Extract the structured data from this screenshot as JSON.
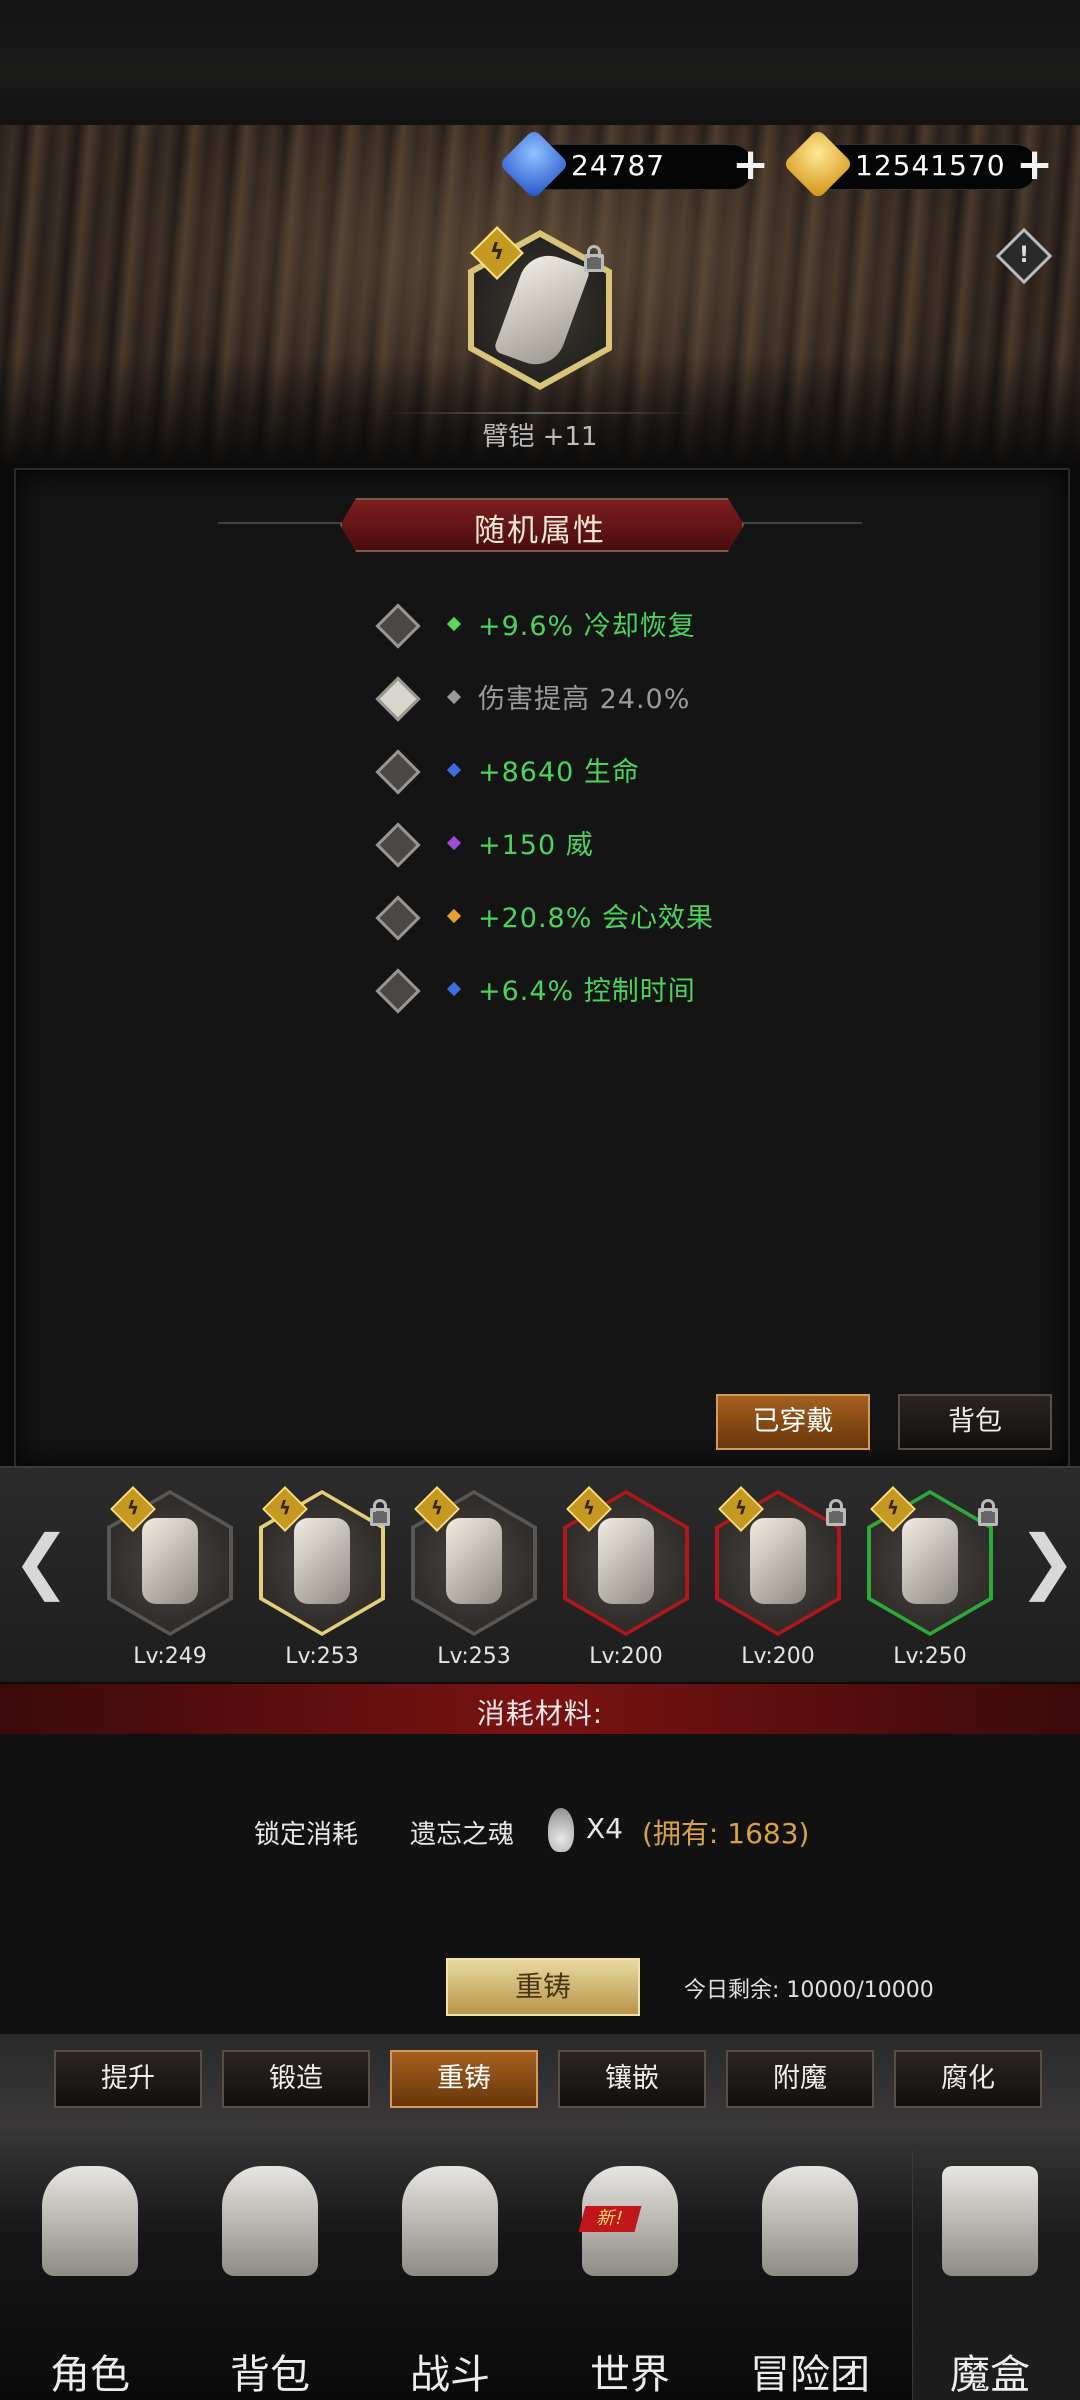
{
  "currency": {
    "gems": "24787",
    "gold": "12541570",
    "gem_color": "#3b6fe0",
    "gold_color": "#e9b21e"
  },
  "item": {
    "name": "臂铠 +11"
  },
  "random_attributes": {
    "title": "随机属性",
    "attrs": [
      {
        "text": "+9.6% 冷却恢复",
        "color": "#4bd45c",
        "dot": "#58d758",
        "locked": false
      },
      {
        "text": "伤害提高 24.0%",
        "color": "#9b9b9b",
        "dot": "#9a9a9a",
        "locked": true
      },
      {
        "text": "+8640 生命",
        "color": "#4bd45c",
        "dot": "#3a6fe0",
        "locked": false
      },
      {
        "text": "+150 威",
        "color": "#4bd45c",
        "dot": "#a24ad8",
        "locked": false
      },
      {
        "text": "+20.8% 会心效果",
        "color": "#4bd45c",
        "dot": "#e0a230",
        "locked": false
      },
      {
        "text": "+6.4% 控制时间",
        "color": "#4bd45c",
        "dot": "#3a6fe0",
        "locked": false
      }
    ]
  },
  "panel_buttons": {
    "equipped": "已穿戴",
    "bag": "背包"
  },
  "equipment": {
    "prev_arrow": "❮",
    "next_arrow": "❯",
    "badge_glyph": "ϟ",
    "slots": [
      {
        "level": "Lv:249",
        "frame": "#5a5654",
        "locked": false
      },
      {
        "level": "Lv:253",
        "frame": "#e3cf7a",
        "locked": true
      },
      {
        "level": "Lv:253",
        "frame": "#5a5654",
        "locked": false
      },
      {
        "level": "Lv:200",
        "frame": "#b0171a",
        "locked": false
      },
      {
        "level": "Lv:200",
        "frame": "#b0171a",
        "locked": true
      },
      {
        "level": "Lv:250",
        "frame": "#2fa83a",
        "locked": true
      }
    ]
  },
  "materials": {
    "title": "消耗材料:",
    "lock_cost_label": "锁定消耗",
    "item_name": "遗忘之魂",
    "quantity": "X4",
    "owned": "(拥有: 1683)"
  },
  "reforge": {
    "button": "重铸",
    "remaining": "今日剩余: 10000/10000"
  },
  "tabs": [
    {
      "label": "提升",
      "active": false
    },
    {
      "label": "锻造",
      "active": false
    },
    {
      "label": "重铸",
      "active": true
    },
    {
      "label": "镶嵌",
      "active": false
    },
    {
      "label": "附魔",
      "active": false
    },
    {
      "label": "腐化",
      "active": false
    }
  ],
  "nav": {
    "new_badge": "新!",
    "items": [
      {
        "label": "角色"
      },
      {
        "label": "背包"
      },
      {
        "label": "战斗"
      },
      {
        "label": "世界"
      },
      {
        "label": "冒险团"
      },
      {
        "label": "魔盒"
      }
    ]
  },
  "warning_glyph": "!"
}
